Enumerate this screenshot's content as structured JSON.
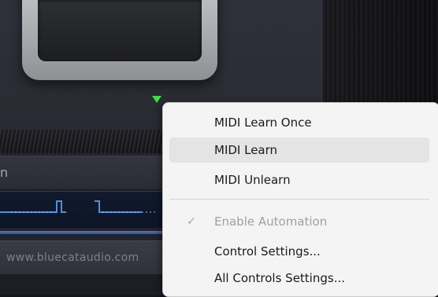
{
  "plugin": {
    "label_bar_text": "n",
    "url_text": "www.bluecataudio.com",
    "indicator_color": "#3ee03e",
    "accent_blue": "#4a7bd0"
  },
  "context_menu": {
    "items": [
      {
        "label": "MIDI Learn Once",
        "enabled": true,
        "checked": false,
        "hovered": false
      },
      {
        "label": "MIDI Learn",
        "enabled": true,
        "checked": false,
        "hovered": true
      },
      {
        "label": "MIDI Unlearn",
        "enabled": true,
        "checked": false,
        "hovered": false
      },
      {
        "label": "Enable Automation",
        "enabled": false,
        "checked": true,
        "hovered": false
      },
      {
        "label": "Control Settings...",
        "enabled": true,
        "checked": false,
        "hovered": false
      },
      {
        "label": "All Controls Settings...",
        "enabled": true,
        "checked": false,
        "hovered": false
      }
    ],
    "check_glyph": "✓"
  }
}
